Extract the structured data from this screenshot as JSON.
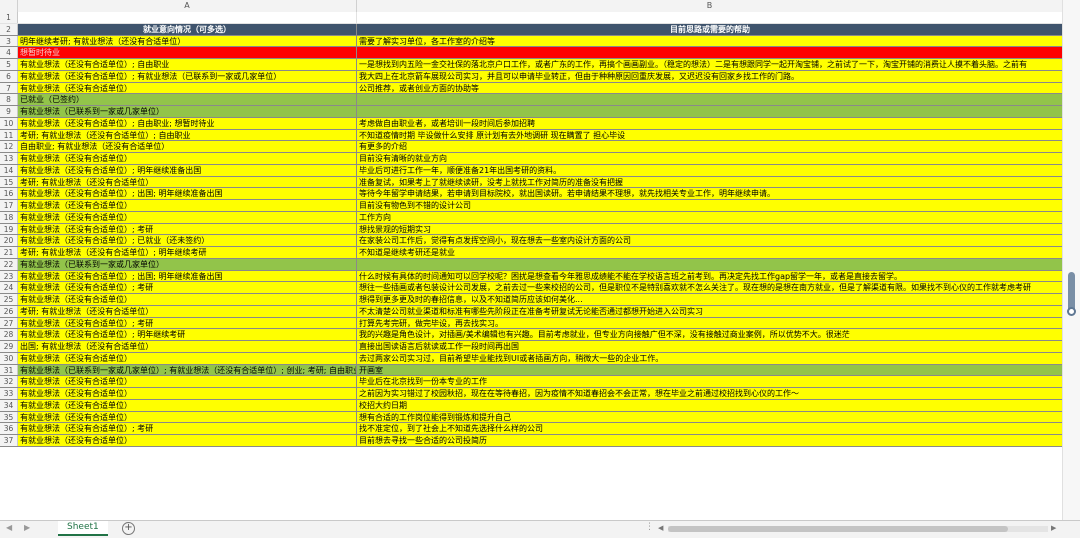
{
  "sheet": {
    "column_headers": [
      "A",
      "B"
    ],
    "colors": {
      "header": "#3f546d",
      "yellow": "#ffff00",
      "red": "#ff0000",
      "green": "#92c44a"
    },
    "rows": [
      {
        "n": "1",
        "style": "blank",
        "a": "",
        "b": ""
      },
      {
        "n": "2",
        "style": "header",
        "a": "就业意向情况（可多选）",
        "b": "目前思路或需要的帮助"
      },
      {
        "n": "3",
        "style": "yellow",
        "a": "明年继续考研; 有就业想法（还没有合适单位）",
        "b": "需要了解实习单位，各工作室的介绍等"
      },
      {
        "n": "4",
        "style": "red",
        "a": "想暂时待业",
        "b": ""
      },
      {
        "n": "5",
        "style": "yellow",
        "a": "有就业想法（还没有合适单位）; 自由职业",
        "b": "一是想找到内五险一金交社保的落北京户口工作，或者广东的工作，再搞个画画副业。（稳定的想法）二是有想跟同学一起开淘宝铺，之前试了一下，淘宝开铺的消费让人摸不着头脑。之前有"
      },
      {
        "n": "6",
        "style": "yellow",
        "a": "有就业想法（还没有合适单位）; 有就业想法（已联系到一家或几家单位）",
        "b": "我大四上在北京箭车展现公司实习，并且可以申请毕业转正，但由于种种原因回重庆发展，又迟迟没有回家乡找工作的门路。"
      },
      {
        "n": "7",
        "style": "yellow",
        "a": "有就业想法（还没有合适单位）",
        "b": "公司推荐，或者创业方面的协助等"
      },
      {
        "n": "8",
        "style": "green",
        "a": "已就业（已签约）",
        "b": ""
      },
      {
        "n": "9",
        "style": "green",
        "a": "有就业想法（已联系到一家或几家单位）",
        "b": ""
      },
      {
        "n": "10",
        "style": "yellow",
        "a": "有就业想法（还没有合适单位）; 自由职业; 想暂时待业",
        "b": "考虑做自由职业者，或者培训一段时间后参加招聘"
      },
      {
        "n": "11",
        "style": "yellow",
        "a": "考研; 有就业想法（还没有合适单位）; 自由职业",
        "b": "不知道疫情时期 毕设做什么安排 原计划有去外地调研 现在瞒置了 担心毕设"
      },
      {
        "n": "12",
        "style": "yellow",
        "a": "自由职业; 有就业想法（还没有合适单位）",
        "b": "有更多的介绍"
      },
      {
        "n": "13",
        "style": "yellow",
        "a": "有就业想法（还没有合适单位）",
        "b": "目前没有清晰的就业方向"
      },
      {
        "n": "14",
        "style": "yellow",
        "a": "有就业想法（还没有合适单位）; 明年继续准备出国",
        "b": "毕业后可进行工作一年，顺便准备21年出国考研的资料。"
      },
      {
        "n": "15",
        "style": "yellow",
        "a": "考研; 有就业想法（还没有合适单位）",
        "b": "准备复试，如果考上了就继续读研，没考上就找工作对简历的准备没有把握"
      },
      {
        "n": "16",
        "style": "yellow",
        "a": "有就业想法（还没有合适单位）; 出国; 明年继续准备出国",
        "b": "等待今年留学申请结果，若申请到目标院校，就出国读研。若申请结果不理想，就先找相关专业工作，明年继续申请。"
      },
      {
        "n": "17",
        "style": "yellow",
        "a": "有就业想法（还没有合适单位）",
        "b": "目前没有物色到不错的设计公司"
      },
      {
        "n": "18",
        "style": "yellow",
        "a": "有就业想法（还没有合适单位）",
        "b": "工作方向"
      },
      {
        "n": "19",
        "style": "yellow",
        "a": "有就业想法（还没有合适单位）; 考研",
        "b": "想找景观的短期实习"
      },
      {
        "n": "20",
        "style": "yellow",
        "a": "有就业想法（还没有合适单位）; 已就业（还未签约）",
        "b": "在家装公司工作后，觉得有点发挥空间小，现在想去一些室内设计方面的公司"
      },
      {
        "n": "21",
        "style": "yellow",
        "a": "考研; 有就业想法（还没有合适单位）; 明年继续考研",
        "b": "不知道是继续考研还是就业"
      },
      {
        "n": "22",
        "style": "green",
        "a": "有就业想法（已联系到一家或几家单位）",
        "b": ""
      },
      {
        "n": "23",
        "style": "yellow",
        "a": "有就业想法（还没有合适单位）; 出国; 明年继续准备出国",
        "b": "什么时候有具体的时间通知可以回学校呢？困扰是想查看今年雅思成绩能不能在学校语言班之前考到。再决定先找工作gap留学一年，或者是直接去留学。"
      },
      {
        "n": "24",
        "style": "yellow",
        "a": "有就业想法（还没有合适单位）; 考研",
        "b": "想往一些插画或者包装设计公司发展，之前去过一些来校招的公司，但是职位不是特别喜欢就不怎么关注了。现在想的是想在南方就业，但是了解渠道有限。如果找不到心仪的工作就考虑考研"
      },
      {
        "n": "25",
        "style": "yellow",
        "a": "有就业想法（还没有合适单位）",
        "b": "想得到更多更及时的春招信息，以及不知道简历应该如何美化..."
      },
      {
        "n": "26",
        "style": "yellow",
        "a": "考研; 有就业想法（还没有合适单位）",
        "b": "不太清楚公司就业渠道和标准有哪些先阶段正在准备考研复试无论能否通过都想开始进入公司实习"
      },
      {
        "n": "27",
        "style": "yellow",
        "a": "有就业想法（还没有合适单位）; 考研",
        "b": "打算先考完研，做完毕设，再去找实习。"
      },
      {
        "n": "28",
        "style": "yellow",
        "a": "有就业想法（还没有合适单位）; 明年继续考研",
        "b": "我的兴趣是角色设计，对插画/美术编辑也有兴趣。目前考虑就业，但专业方向接触广但不深，没有接触过商业案例，所以优势不大。很迷茫"
      },
      {
        "n": "29",
        "style": "yellow",
        "a": "出国; 有就业想法（还没有合适单位）",
        "b": "直接出国读语言后就读或工作一段时间再出国"
      },
      {
        "n": "30",
        "style": "yellow",
        "a": "有就业想法（还没有合适单位）",
        "b": "去过两家公司实习过，目前希望毕业能找到UI或者插画方向，稍微大一些的企业工作。"
      },
      {
        "n": "31",
        "style": "green",
        "a": "有就业想法（已联系到一家或几家单位）; 有就业想法（还没有合适单位）; 创业; 考研; 自由职业",
        "b": "开画室"
      },
      {
        "n": "32",
        "style": "yellow",
        "a": "有就业想法（还没有合适单位）",
        "b": "毕业后在北京找到一份本专业的工作"
      },
      {
        "n": "33",
        "style": "yellow",
        "a": "有就业想法（还没有合适单位）",
        "b": "之前因为实习错过了校园秋招，现在在等待春招，因为疫情不知道春招会不会正常，想在毕业之前通过校招找到心仪的工作～"
      },
      {
        "n": "34",
        "style": "yellow",
        "a": "有就业想法（还没有合适单位）",
        "b": "校招大约日期"
      },
      {
        "n": "35",
        "style": "yellow",
        "a": "有就业想法（还没有合适单位）",
        "b": "想有合适的工作岗位能得到锻炼和提升自己"
      },
      {
        "n": "36",
        "style": "yellow",
        "a": "有就业想法（还没有合适单位）; 考研",
        "b": "找不准定位，到了社会上不知道先选择什么样的公司"
      },
      {
        "n": "37",
        "style": "yellow",
        "a": "有就业想法（还没有合适单位）",
        "b": "目前想去寻找一些合适的公司投简历"
      }
    ]
  },
  "tabs": {
    "sheet_name": "Sheet1",
    "add_symbol": "+",
    "ellipsis": "⋮",
    "prev_arrow": "◀",
    "next_arrow": "▶"
  }
}
